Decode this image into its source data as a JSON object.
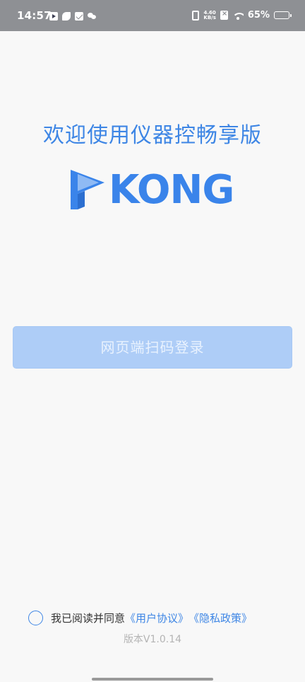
{
  "status_bar": {
    "time": "14:57",
    "net_speed_value": "4.60",
    "net_speed_unit": "KB/s",
    "battery": "65%",
    "battery_level": 0.65
  },
  "welcome": "欢迎使用仪器控畅享版",
  "logo": {
    "text": "KONG",
    "color": "#3a84ea"
  },
  "login_button": "网页端扫码登录",
  "agreement": {
    "prefix": "我已阅读并同意",
    "user_agreement": "《用户协议》",
    "privacy_policy": "《隐私政策》"
  },
  "version": "版本V1.0.14",
  "colors": {
    "accent": "#3e86e5",
    "button_disabled": "#aecdf7"
  }
}
